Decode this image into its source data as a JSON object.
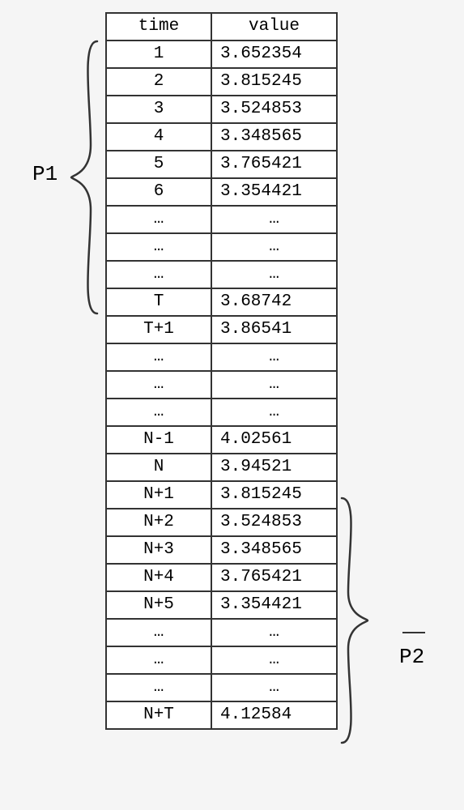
{
  "labels": {
    "p1": "P1",
    "p2": "P2"
  },
  "columns": {
    "time": "time",
    "value": "value"
  },
  "rows": [
    {
      "time": "time",
      "value": "value",
      "kind": "hdr"
    },
    {
      "time": "1",
      "value": "3.652354"
    },
    {
      "time": "2",
      "value": "3.815245"
    },
    {
      "time": "3",
      "value": "3.524853"
    },
    {
      "time": "4",
      "value": "3.348565"
    },
    {
      "time": "5",
      "value": "3.765421"
    },
    {
      "time": "6",
      "value": "3.354421"
    },
    {
      "time": "…",
      "value": "…",
      "kind": "dots"
    },
    {
      "time": "…",
      "value": "…",
      "kind": "dots"
    },
    {
      "time": "…",
      "value": "…",
      "kind": "dots"
    },
    {
      "time": "T",
      "value": "3.68742"
    },
    {
      "time": "T+1",
      "value": "3.86541"
    },
    {
      "time": "…",
      "value": "…",
      "kind": "dots"
    },
    {
      "time": "…",
      "value": "…",
      "kind": "dots"
    },
    {
      "time": "…",
      "value": "…",
      "kind": "dots"
    },
    {
      "time": "N-1",
      "value": "4.02561"
    },
    {
      "time": "N",
      "value": "3.94521"
    },
    {
      "time": "N+1",
      "value": "3.815245"
    },
    {
      "time": "N+2",
      "value": "3.524853"
    },
    {
      "time": "N+3",
      "value": "3.348565"
    },
    {
      "time": "N+4",
      "value": "3.765421"
    },
    {
      "time": "N+5",
      "value": "3.354421"
    },
    {
      "time": "…",
      "value": "…",
      "kind": "dots"
    },
    {
      "time": "…",
      "value": "…",
      "kind": "dots"
    },
    {
      "time": "…",
      "value": "…",
      "kind": "dots"
    },
    {
      "time": "N+T",
      "value": "4.12584"
    }
  ]
}
